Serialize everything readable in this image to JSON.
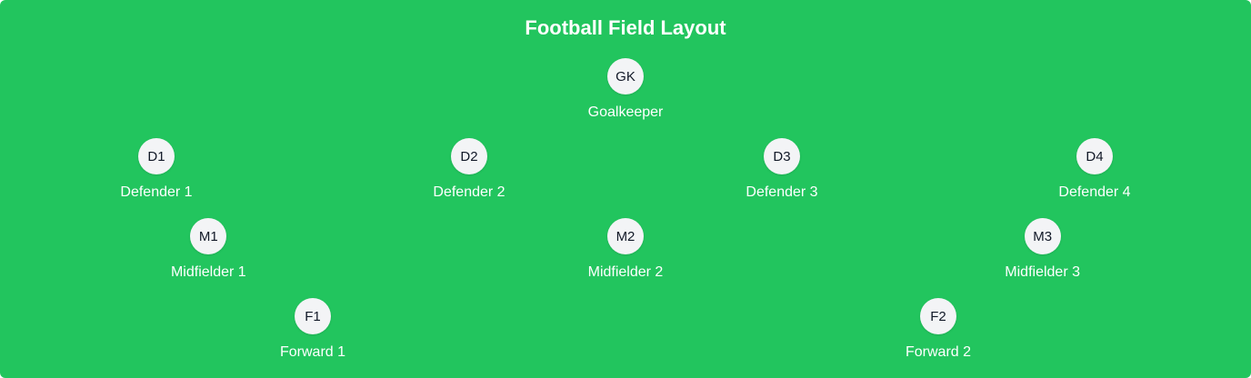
{
  "title": "Football Field Layout",
  "colors": {
    "field": "#22c55e",
    "marker": "#f3f4f6",
    "marker_text": "#111827",
    "label_text": "#ffffff"
  },
  "goalkeeper": {
    "code": "GK",
    "name": "Goalkeeper"
  },
  "defenders": [
    {
      "code": "D1",
      "name": "Defender 1"
    },
    {
      "code": "D2",
      "name": "Defender 2"
    },
    {
      "code": "D3",
      "name": "Defender 3"
    },
    {
      "code": "D4",
      "name": "Defender 4"
    }
  ],
  "midfielders": [
    {
      "code": "M1",
      "name": "Midfielder 1"
    },
    {
      "code": "M2",
      "name": "Midfielder 2"
    },
    {
      "code": "M3",
      "name": "Midfielder 3"
    }
  ],
  "forwards": [
    {
      "code": "F1",
      "name": "Forward 1"
    },
    {
      "code": "F2",
      "name": "Forward 2"
    }
  ]
}
